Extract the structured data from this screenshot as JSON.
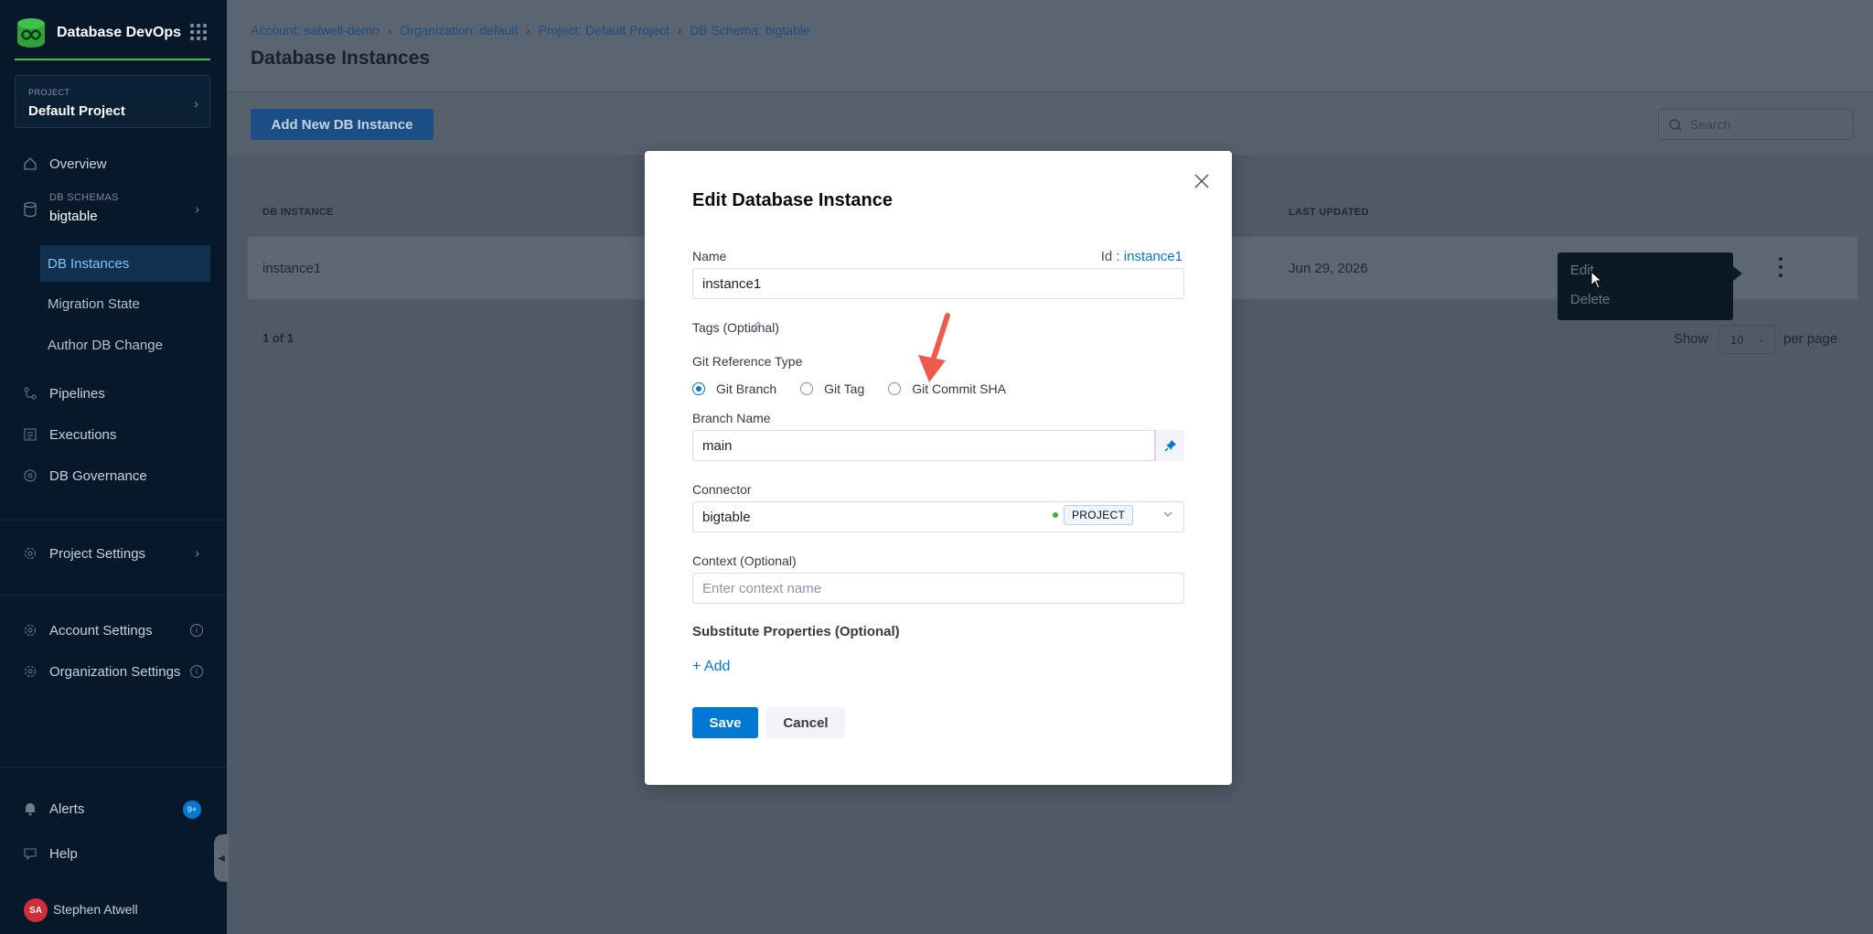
{
  "sidebar": {
    "brand_title": "Database DevOps",
    "project_caption": "PROJECT",
    "project_name": "Default Project",
    "overview": "Overview",
    "db_schemas_caption": "DB SCHEMAS",
    "db_schema_value": "bigtable",
    "sub_items": [
      "DB Instances",
      "Migration State",
      "Author DB Change"
    ],
    "pipelines": "Pipelines",
    "executions": "Executions",
    "db_governance": "DB Governance",
    "project_settings": "Project Settings",
    "account_settings": "Account Settings",
    "organization_settings": "Organization Settings",
    "alerts": "Alerts",
    "alerts_badge": "9+",
    "help": "Help",
    "user_initials": "SA",
    "user_name": "Stephen Atwell"
  },
  "header": {
    "breadcrumb": [
      "Account: satwell-demo",
      "Organization: default",
      "Project: Default Project",
      "DB Schema: bigtable"
    ],
    "title": "Database Instances"
  },
  "toolbar": {
    "add_button": "Add New DB Instance",
    "search_placeholder": "Search"
  },
  "table": {
    "columns": [
      "DB INSTANCE",
      "LAST UPDATED"
    ],
    "rows": [
      {
        "name": "instance1",
        "last_updated": "Jun 29, 2026"
      }
    ],
    "pager_count": "1 of 1",
    "show_label": "Show",
    "page_size": "10",
    "per_page_label": "per page"
  },
  "context_menu": {
    "items": [
      "Edit",
      "Delete"
    ]
  },
  "modal": {
    "title": "Edit Database Instance",
    "name_label": "Name",
    "id_key": "Id :",
    "id_value": "instance1",
    "name_value": "instance1",
    "tags_label": "Tags (Optional)",
    "git_ref_label": "Git Reference Type",
    "git_ref_options": [
      "Git Branch",
      "Git Tag",
      "Git Commit SHA"
    ],
    "git_ref_selected": "Git Branch",
    "branch_label": "Branch Name",
    "branch_value": "main",
    "connector_label": "Connector",
    "connector_value": "bigtable",
    "connector_scope": "PROJECT",
    "context_label": "Context (Optional)",
    "context_placeholder": "Enter context name",
    "substitute_label": "Substitute Properties (Optional)",
    "add_link": "+ Add",
    "save_label": "Save",
    "cancel_label": "Cancel"
  },
  "colors": {
    "accent": "#0278d5",
    "sidebar_bg": "#07182b",
    "brand_green": "#3dc24b",
    "annotation_arrow": "#f05a4a"
  }
}
